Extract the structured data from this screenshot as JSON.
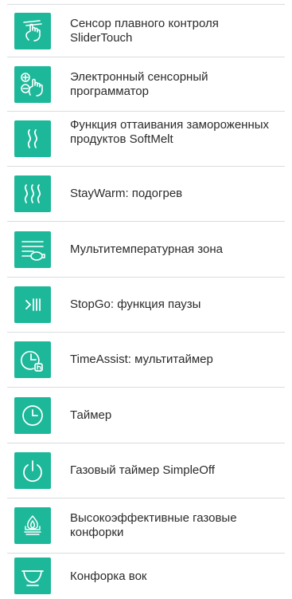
{
  "features": [
    {
      "icon": "slider-touch-icon",
      "label": "Сенсор плавного контроля SliderTouch"
    },
    {
      "icon": "touch-programmer-icon",
      "label": "Электронный сенсорный программатор"
    },
    {
      "icon": "softmelt-waves-icon",
      "label": "Функция оттаивания замороженных продуктов SoftMelt"
    },
    {
      "icon": "staywarm-waves-icon",
      "label": "StayWarm: подогрев"
    },
    {
      "icon": "multitemperature-zone-icon",
      "label": "Мультитемпературная зона"
    },
    {
      "icon": "stopgo-pause-icon",
      "label": "StopGo: функция паузы"
    },
    {
      "icon": "timeassist-clock-icon",
      "label": "TimeAssist: мультитаймер"
    },
    {
      "icon": "timer-clock-icon",
      "label": "Таймер"
    },
    {
      "icon": "gas-timer-power-icon",
      "label": "Газовый таймер SimpleOff"
    },
    {
      "icon": "gas-burner-flame-icon",
      "label": "Высокоэффективные газовые конфорки"
    },
    {
      "icon": "wok-burner-icon",
      "label": "Конфорка вок"
    }
  ],
  "colors": {
    "icon_bg": "#1db89a",
    "icon_fg": "#ffffff",
    "text": "#2b2b2b",
    "divider": "#d9dcdf"
  }
}
